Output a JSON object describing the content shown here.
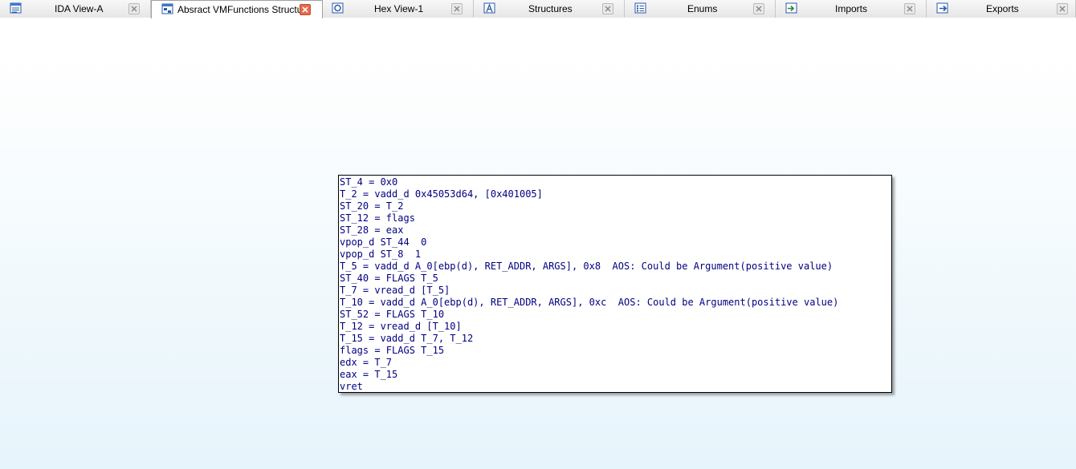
{
  "tabs": [
    {
      "label": "IDA View-A",
      "icon": "ida-view-icon",
      "active": false
    },
    {
      "label": "Absract VMFunctions Structure",
      "icon": "graph-view-icon",
      "active": true
    },
    {
      "label": "Hex View-1",
      "icon": "hex-view-icon",
      "active": false
    },
    {
      "label": "Structures",
      "icon": "structures-icon",
      "active": false
    },
    {
      "label": "Enums",
      "icon": "enums-icon",
      "active": false
    },
    {
      "label": "Imports",
      "icon": "imports-icon",
      "active": false
    },
    {
      "label": "Exports",
      "icon": "exports-icon",
      "active": false
    }
  ],
  "node": {
    "lines": [
      "ST_4 = 0x0",
      "T_2 = vadd_d 0x45053d64, [0x401005]",
      "ST_20 = T_2",
      "ST_12 = flags",
      "ST_28 = eax",
      "vpop_d ST_44  0",
      "vpop_d ST_8  1",
      "T_5 = vadd_d A_0[ebp(d), RET_ADDR, ARGS], 0x8  AOS: Could be Argument(positive value)",
      "ST_40 = FLAGS T_5",
      "T_7 = vread_d [T_5]",
      "T_10 = vadd_d A_0[ebp(d), RET_ADDR, ARGS], 0xc  AOS: Could be Argument(positive value)",
      "ST_52 = FLAGS T_10",
      "T_12 = vread_d [T_10]",
      "T_15 = vadd_d T_7, T_12",
      "flags = FLAGS T_15",
      "edx = T_7",
      "eax = T_15",
      "vret"
    ]
  },
  "colors": {
    "code_text": "#000080",
    "active_close": "#e86a4a",
    "canvas_bottom": "#e6f4fb"
  }
}
